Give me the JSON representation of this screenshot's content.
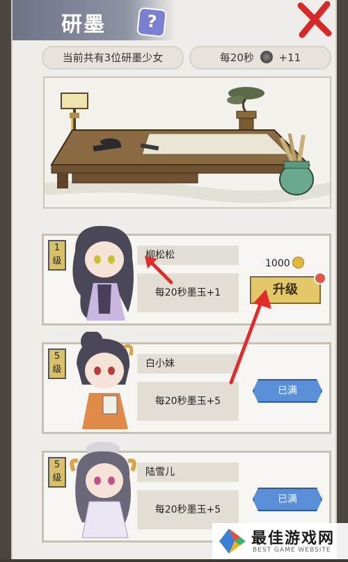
{
  "header": {
    "title": "研墨",
    "help_label": "?"
  },
  "stats": {
    "maidens_text": "当前共有3位研墨少女",
    "rate_prefix": "每20秒",
    "rate_value": "+11"
  },
  "characters": [
    {
      "level_num": "1",
      "level_unit": "级",
      "name": "柳松松",
      "effect": "每20秒墨玉+1",
      "cost": "1000",
      "button_label": "升级",
      "state": "upgradable"
    },
    {
      "level_num": "5",
      "level_unit": "级",
      "name": "白小妹",
      "effect": "每20秒墨玉+5",
      "button_label": "已满",
      "state": "maxed"
    },
    {
      "level_num": "5",
      "level_unit": "级",
      "name": "陆雪儿",
      "effect": "每20秒墨玉+5",
      "button_label": "已满",
      "state": "maxed"
    }
  ],
  "watermark": {
    "name": "最佳游戏网",
    "subtitle": "BEST GAME WEBSITE"
  },
  "colors": {
    "accent_gold": "#e3c768",
    "maxed_blue": "#5a8fd8",
    "arrow_red": "#e02b2b",
    "title_bar": "#7d8294"
  }
}
